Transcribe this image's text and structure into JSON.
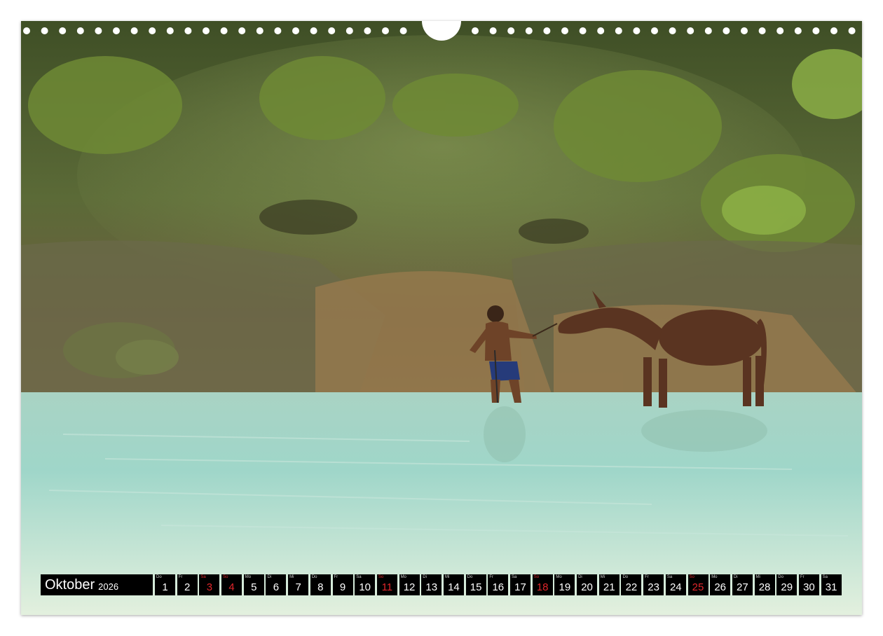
{
  "calendar": {
    "month": "Oktober",
    "year": "2026",
    "days": [
      {
        "wd": "Do",
        "num": "1",
        "red": false
      },
      {
        "wd": "Fr",
        "num": "2",
        "red": false
      },
      {
        "wd": "Sa",
        "num": "3",
        "red": true
      },
      {
        "wd": "So",
        "num": "4",
        "red": true
      },
      {
        "wd": "Mo",
        "num": "5",
        "red": false
      },
      {
        "wd": "Di",
        "num": "6",
        "red": false
      },
      {
        "wd": "Mi",
        "num": "7",
        "red": false
      },
      {
        "wd": "Do",
        "num": "8",
        "red": false
      },
      {
        "wd": "Fr",
        "num": "9",
        "red": false
      },
      {
        "wd": "Sa",
        "num": "10",
        "red": false
      },
      {
        "wd": "So",
        "num": "11",
        "red": true
      },
      {
        "wd": "Mo",
        "num": "12",
        "red": false
      },
      {
        "wd": "Di",
        "num": "13",
        "red": false
      },
      {
        "wd": "Mi",
        "num": "14",
        "red": false
      },
      {
        "wd": "Do",
        "num": "15",
        "red": false
      },
      {
        "wd": "Fr",
        "num": "16",
        "red": false
      },
      {
        "wd": "Sa",
        "num": "17",
        "red": false
      },
      {
        "wd": "So",
        "num": "18",
        "red": true
      },
      {
        "wd": "Mo",
        "num": "19",
        "red": false
      },
      {
        "wd": "Di",
        "num": "20",
        "red": false
      },
      {
        "wd": "Mi",
        "num": "21",
        "red": false
      },
      {
        "wd": "Do",
        "num": "22",
        "red": false
      },
      {
        "wd": "Fr",
        "num": "23",
        "red": false
      },
      {
        "wd": "Sa",
        "num": "24",
        "red": false
      },
      {
        "wd": "So",
        "num": "25",
        "red": true
      },
      {
        "wd": "Mo",
        "num": "26",
        "red": false
      },
      {
        "wd": "Di",
        "num": "27",
        "red": false
      },
      {
        "wd": "Mi",
        "num": "28",
        "red": false
      },
      {
        "wd": "Do",
        "num": "29",
        "red": false
      },
      {
        "wd": "Fr",
        "num": "30",
        "red": false
      },
      {
        "wd": "Sa",
        "num": "31",
        "red": false
      }
    ]
  },
  "colors": {
    "calendar_bg": "#000000",
    "sunday_red": "#e0262b",
    "water": "#bfe3d6",
    "foliage": "#4e6a2c"
  }
}
